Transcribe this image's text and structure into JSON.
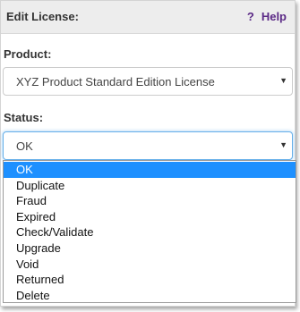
{
  "header": {
    "title": "Edit License:",
    "help_label": "Help",
    "help_icon": "question-mark-icon"
  },
  "product": {
    "label": "Product:",
    "value": "XYZ Product Standard Edition License"
  },
  "status": {
    "label": "Status:",
    "value": "OK",
    "options": [
      "OK",
      "Duplicate",
      "Fraud",
      "Expired",
      "Check/Validate",
      "Upgrade",
      "Void",
      "Returned",
      "Delete"
    ],
    "highlighted_index": 0
  },
  "colors": {
    "accent": "#5b2a86",
    "selection": "#1e90ff",
    "header_bg": "#ededed"
  }
}
